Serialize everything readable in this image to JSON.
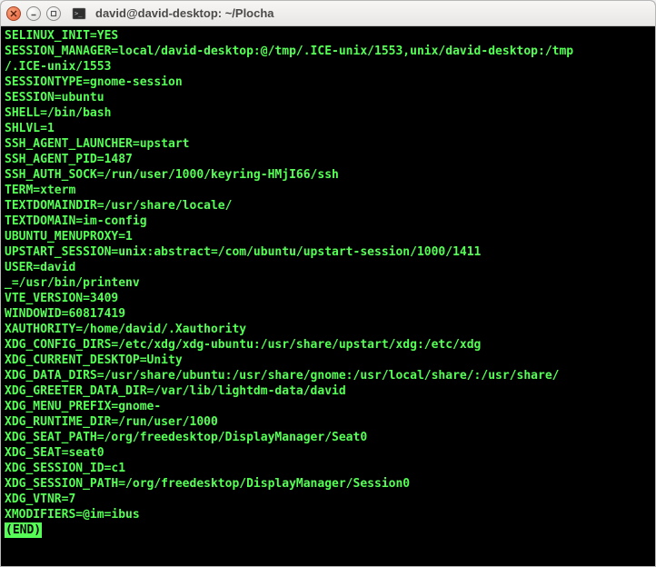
{
  "window": {
    "title": "david@david-desktop: ~/Plocha"
  },
  "terminal": {
    "lines": [
      "SELINUX_INIT=YES",
      "SESSION_MANAGER=local/david-desktop:@/tmp/.ICE-unix/1553,unix/david-desktop:/tmp",
      "/.ICE-unix/1553",
      "SESSIONTYPE=gnome-session",
      "SESSION=ubuntu",
      "SHELL=/bin/bash",
      "SHLVL=1",
      "SSH_AGENT_LAUNCHER=upstart",
      "SSH_AGENT_PID=1487",
      "SSH_AUTH_SOCK=/run/user/1000/keyring-HMjI66/ssh",
      "TERM=xterm",
      "TEXTDOMAINDIR=/usr/share/locale/",
      "TEXTDOMAIN=im-config",
      "UBUNTU_MENUPROXY=1",
      "UPSTART_SESSION=unix:abstract=/com/ubuntu/upstart-session/1000/1411",
      "USER=david",
      "_=/usr/bin/printenv",
      "VTE_VERSION=3409",
      "WINDOWID=60817419",
      "XAUTHORITY=/home/david/.Xauthority",
      "XDG_CONFIG_DIRS=/etc/xdg/xdg-ubuntu:/usr/share/upstart/xdg:/etc/xdg",
      "XDG_CURRENT_DESKTOP=Unity",
      "XDG_DATA_DIRS=/usr/share/ubuntu:/usr/share/gnome:/usr/local/share/:/usr/share/",
      "XDG_GREETER_DATA_DIR=/var/lib/lightdm-data/david",
      "XDG_MENU_PREFIX=gnome-",
      "XDG_RUNTIME_DIR=/run/user/1000",
      "XDG_SEAT_PATH=/org/freedesktop/DisplayManager/Seat0",
      "XDG_SEAT=seat0",
      "XDG_SESSION_ID=c1",
      "XDG_SESSION_PATH=/org/freedesktop/DisplayManager/Session0",
      "XDG_VTNR=7",
      "XMODIFIERS=@im=ibus"
    ],
    "end_marker": "(END)"
  }
}
